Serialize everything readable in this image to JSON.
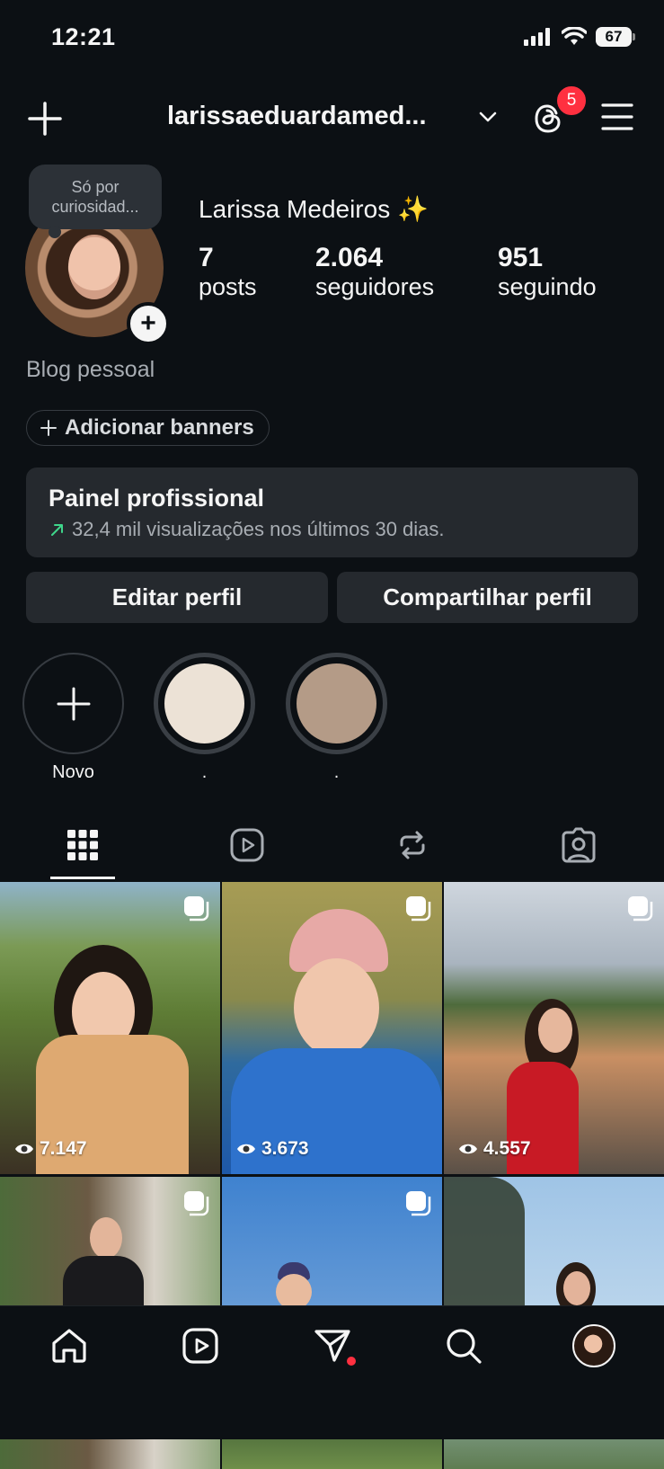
{
  "status_bar": {
    "time": "12:21",
    "battery": "67"
  },
  "header": {
    "username": "larissaeduardamed...",
    "threads_badge": "5"
  },
  "profile": {
    "note": "Só por curiosidad...",
    "name": "Larissa Medeiros ✨",
    "stats": [
      {
        "value": "7",
        "label": "posts"
      },
      {
        "value": "2.064",
        "label": "seguidores"
      },
      {
        "value": "951",
        "label": "seguindo"
      }
    ],
    "category": "Blog pessoal",
    "add_banners": "Adicionar banners"
  },
  "panel": {
    "title": "Painel profissional",
    "subtitle": "32,4 mil visualizações nos últimos 30 dias.",
    "accent_color": "#3fd68b"
  },
  "actions": {
    "edit": "Editar perfil",
    "share": "Compartilhar perfil"
  },
  "highlights": [
    {
      "label": "Novo"
    },
    {
      "label": ".",
      "color": "#ece2d6"
    },
    {
      "label": ".",
      "color": "#b49b87"
    }
  ],
  "tabs": [
    "grid-icon",
    "reels-icon",
    "reposts-icon",
    "tagged-icon"
  ],
  "posts": [
    {
      "views": "7.147",
      "multi": true
    },
    {
      "views": "3.673",
      "multi": true
    },
    {
      "views": "4.557",
      "multi": true
    },
    {
      "views": "",
      "multi": true
    },
    {
      "views": "",
      "multi": true
    },
    {
      "views": "",
      "multi": false
    }
  ],
  "colors": {
    "background": "#0c1014",
    "badge": "#ff3040",
    "unread_dot": "#ff3040"
  }
}
